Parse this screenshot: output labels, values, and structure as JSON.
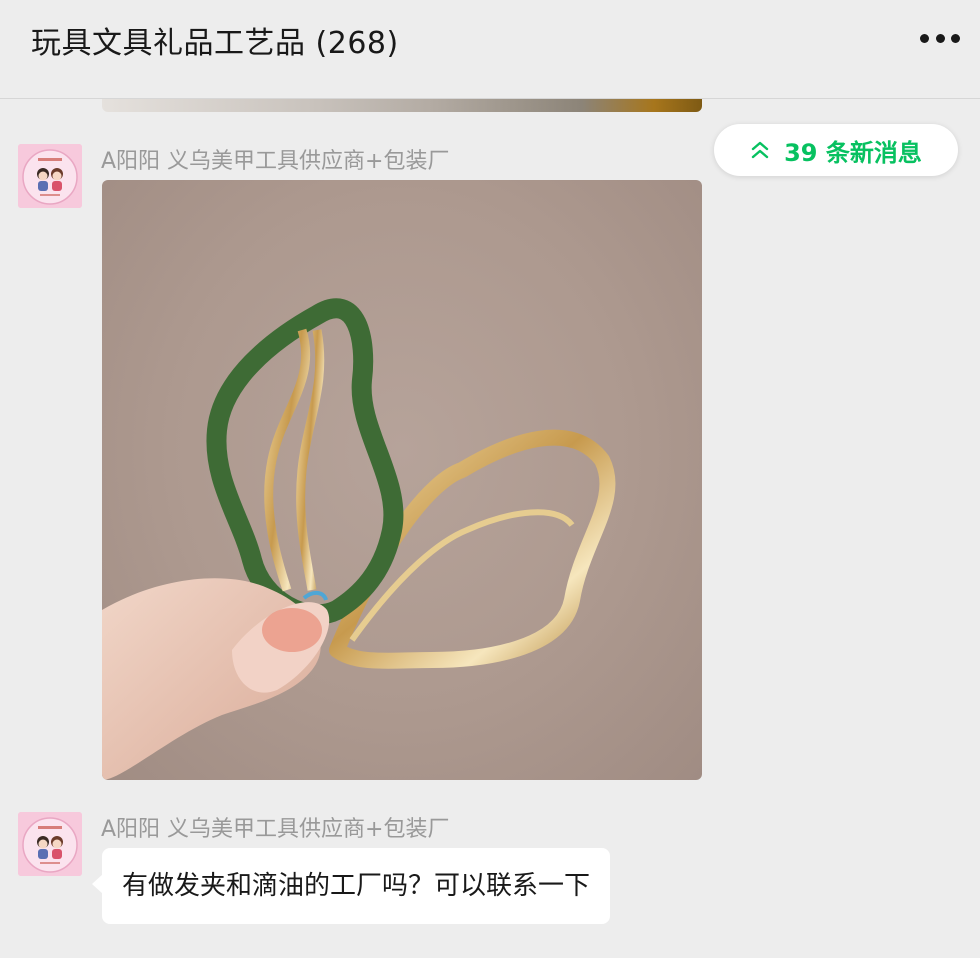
{
  "header": {
    "title": "玩具文具礼品工艺品 (268)",
    "more_icon": "more-dots-icon"
  },
  "new_messages": {
    "label": "39 条新消息",
    "icon": "double-chevron-up-icon",
    "color": "#07c160"
  },
  "messages": [
    {
      "sender": "A阳阳 义乌美甲工具供应商+包装厂",
      "type": "image",
      "image_description_icon": "photo-hairclips"
    },
    {
      "sender": "A阳阳 义乌美甲工具供应商+包装厂",
      "type": "text",
      "text": "有做发夹和滴油的工厂吗？可以联系一下"
    }
  ],
  "colors": {
    "background": "#ededed",
    "bubble": "#ffffff",
    "sender_text": "#999999",
    "accent": "#07c160"
  }
}
